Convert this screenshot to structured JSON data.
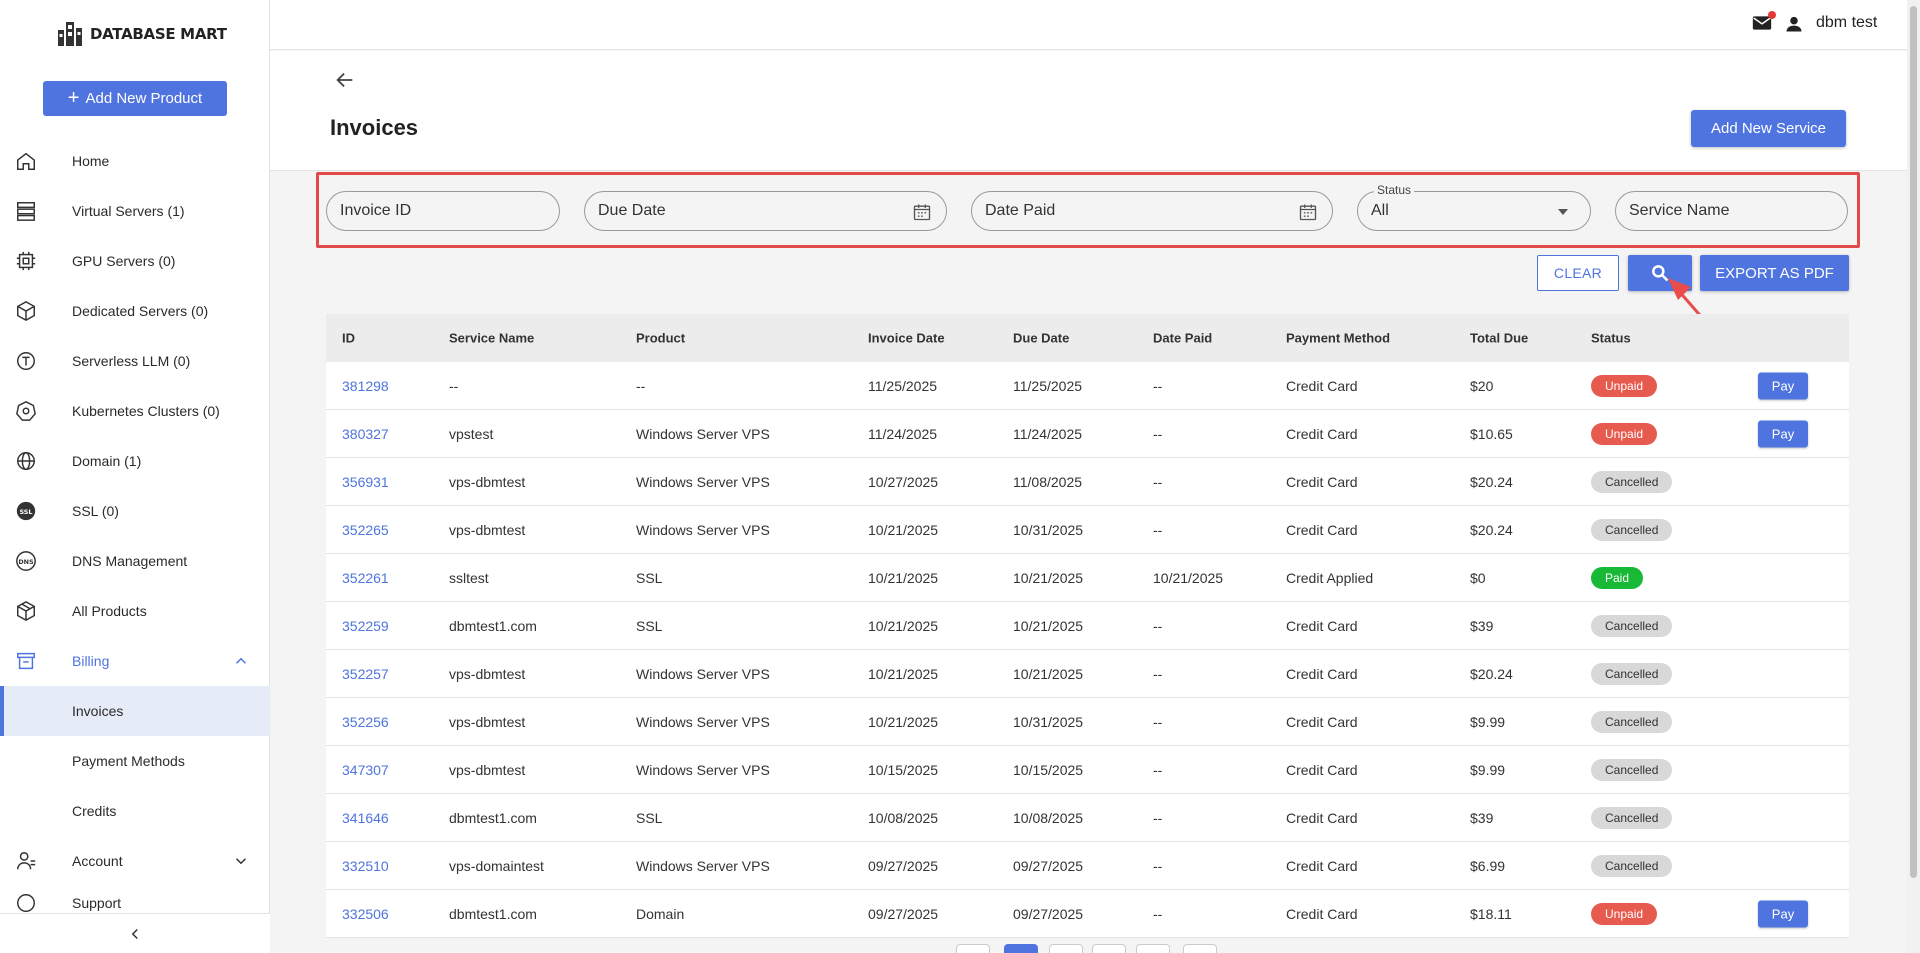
{
  "brand": {
    "name": "DATABASE MART"
  },
  "sidebar": {
    "add_product_label": "Add New Product",
    "items": [
      {
        "label": "Home",
        "icon": "home-icon"
      },
      {
        "label": "Virtual Servers (1)",
        "icon": "server-icon"
      },
      {
        "label": "GPU Servers (0)",
        "icon": "gpu-icon"
      },
      {
        "label": "Dedicated Servers (0)",
        "icon": "cube-icon"
      },
      {
        "label": "Serverless LLM (0)",
        "icon": "llm-icon"
      },
      {
        "label": "Kubernetes Clusters (0)",
        "icon": "kubernetes-icon"
      },
      {
        "label": "Domain (1)",
        "icon": "globe-icon"
      },
      {
        "label": "SSL (0)",
        "icon": "ssl-icon"
      },
      {
        "label": "DNS Management",
        "icon": "dns-icon"
      },
      {
        "label": "All Products",
        "icon": "package-icon"
      }
    ],
    "billing_label": "Billing",
    "billing_sub": [
      "Invoices",
      "Payment Methods",
      "Credits"
    ],
    "account_label": "Account",
    "support_label": "Support"
  },
  "topbar": {
    "user_name": "dbm test"
  },
  "page": {
    "title": "Invoices",
    "add_service_label": "Add New Service"
  },
  "filters": {
    "invoice_id": "Invoice ID",
    "due_date": "Due Date",
    "date_paid": "Date Paid",
    "status_legend": "Status",
    "status_value": "All",
    "service_name": "Service Name"
  },
  "actions": {
    "clear": "CLEAR",
    "export": "EXPORT AS PDF"
  },
  "table": {
    "headers": [
      "ID",
      "Service Name",
      "Product",
      "Invoice Date",
      "Due Date",
      "Date Paid",
      "Payment Method",
      "Total Due",
      "Status"
    ],
    "pay_label": "Pay",
    "rows": [
      {
        "id": "381298",
        "service": "--",
        "product": "--",
        "invoice_date": "11/25/2025",
        "due_date": "11/25/2025",
        "date_paid": "--",
        "method": "Credit Card",
        "total": "$20",
        "status": "Unpaid",
        "pay": true
      },
      {
        "id": "380327",
        "service": "vpstest",
        "product": "Windows Server VPS",
        "invoice_date": "11/24/2025",
        "due_date": "11/24/2025",
        "date_paid": "--",
        "method": "Credit Card",
        "total": "$10.65",
        "status": "Unpaid",
        "pay": true
      },
      {
        "id": "356931",
        "service": "vps-dbmtest",
        "product": "Windows Server VPS",
        "invoice_date": "10/27/2025",
        "due_date": "11/08/2025",
        "date_paid": "--",
        "method": "Credit Card",
        "total": "$20.24",
        "status": "Cancelled",
        "pay": false
      },
      {
        "id": "352265",
        "service": "vps-dbmtest",
        "product": "Windows Server VPS",
        "invoice_date": "10/21/2025",
        "due_date": "10/31/2025",
        "date_paid": "--",
        "method": "Credit Card",
        "total": "$20.24",
        "status": "Cancelled",
        "pay": false
      },
      {
        "id": "352261",
        "service": "ssltest",
        "product": "SSL",
        "invoice_date": "10/21/2025",
        "due_date": "10/21/2025",
        "date_paid": "10/21/2025",
        "method": "Credit Applied",
        "total": "$0",
        "status": "Paid",
        "pay": false
      },
      {
        "id": "352259",
        "service": "dbmtest1.com",
        "product": "SSL",
        "invoice_date": "10/21/2025",
        "due_date": "10/21/2025",
        "date_paid": "--",
        "method": "Credit Card",
        "total": "$39",
        "status": "Cancelled",
        "pay": false
      },
      {
        "id": "352257",
        "service": "vps-dbmtest",
        "product": "Windows Server VPS",
        "invoice_date": "10/21/2025",
        "due_date": "10/21/2025",
        "date_paid": "--",
        "method": "Credit Card",
        "total": "$20.24",
        "status": "Cancelled",
        "pay": false
      },
      {
        "id": "352256",
        "service": "vps-dbmtest",
        "product": "Windows Server VPS",
        "invoice_date": "10/21/2025",
        "due_date": "10/31/2025",
        "date_paid": "--",
        "method": "Credit Card",
        "total": "$9.99",
        "status": "Cancelled",
        "pay": false
      },
      {
        "id": "347307",
        "service": "vps-dbmtest",
        "product": "Windows Server VPS",
        "invoice_date": "10/15/2025",
        "due_date": "10/15/2025",
        "date_paid": "--",
        "method": "Credit Card",
        "total": "$9.99",
        "status": "Cancelled",
        "pay": false
      },
      {
        "id": "341646",
        "service": "dbmtest1.com",
        "product": "SSL",
        "invoice_date": "10/08/2025",
        "due_date": "10/08/2025",
        "date_paid": "--",
        "method": "Credit Card",
        "total": "$39",
        "status": "Cancelled",
        "pay": false
      },
      {
        "id": "332510",
        "service": "vps-domaintest",
        "product": "Windows Server VPS",
        "invoice_date": "09/27/2025",
        "due_date": "09/27/2025",
        "date_paid": "--",
        "method": "Credit Card",
        "total": "$6.99",
        "status": "Cancelled",
        "pay": false
      },
      {
        "id": "332506",
        "service": "dbmtest1.com",
        "product": "Domain",
        "invoice_date": "09/27/2025",
        "due_date": "09/27/2025",
        "date_paid": "--",
        "method": "Credit Card",
        "total": "$18.11",
        "status": "Unpaid",
        "pay": true
      }
    ]
  },
  "colors": {
    "accent": "#4f74e0",
    "unpaid": "#e75b4f",
    "paid": "#17b937",
    "cancelled": "#d8d8d8",
    "highlight": "#e24a4a"
  }
}
